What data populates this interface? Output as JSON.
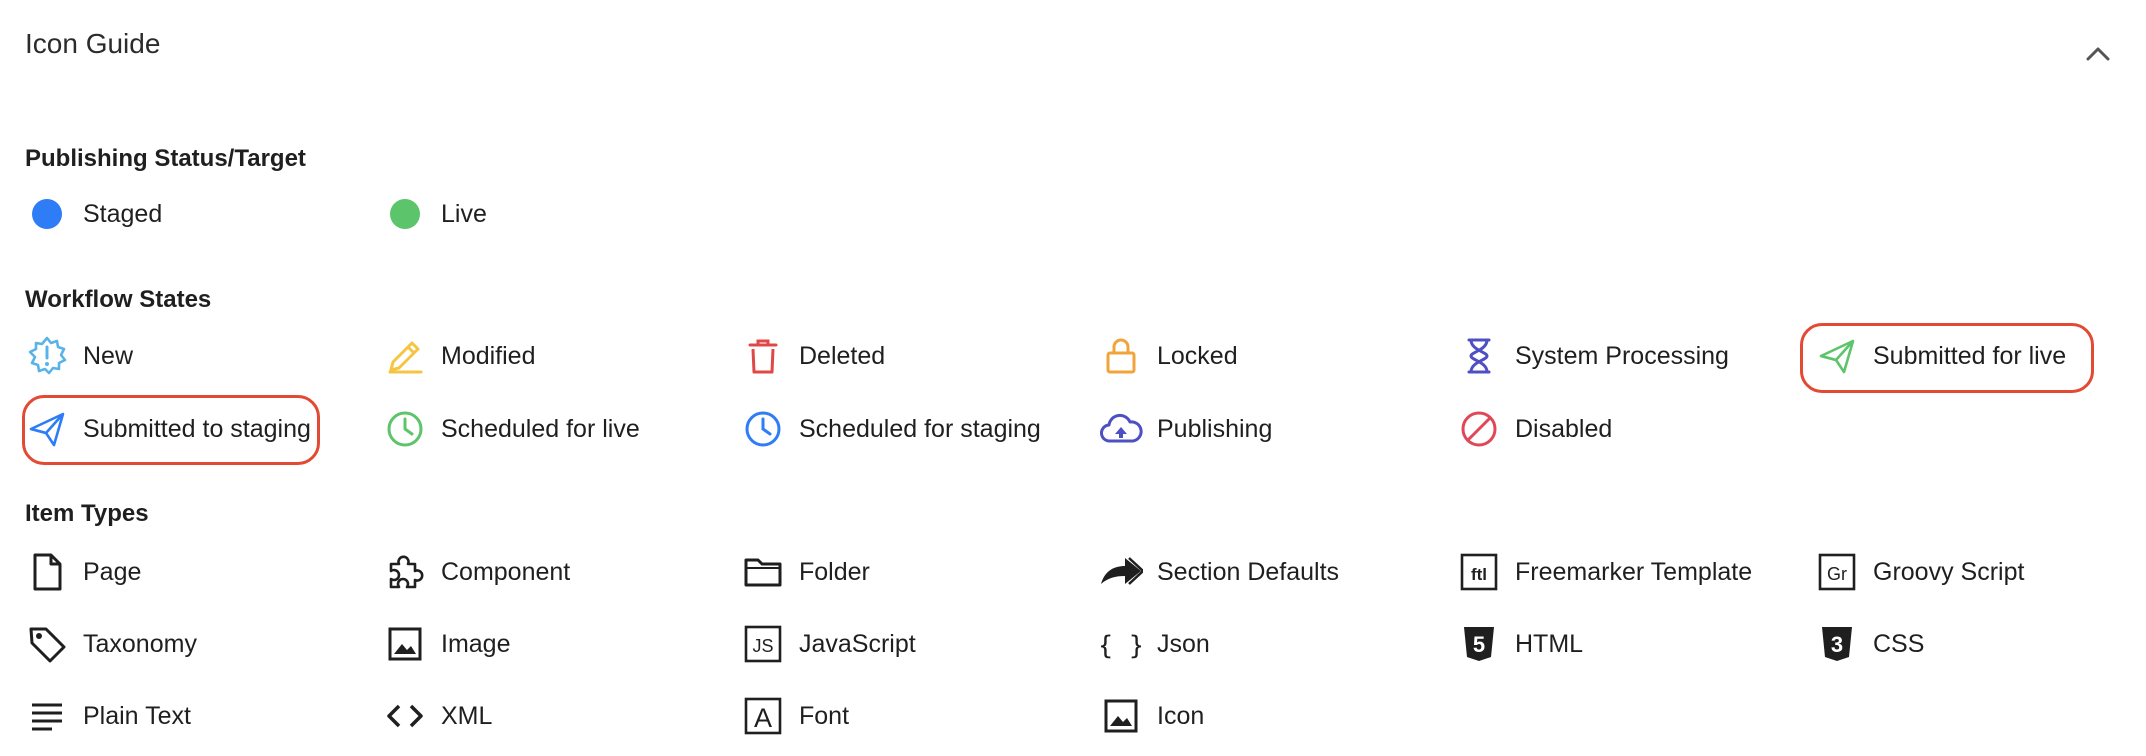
{
  "header": {
    "title": "Icon Guide"
  },
  "sections": {
    "publishing": {
      "title": "Publishing Status/Target"
    },
    "workflow": {
      "title": "Workflow States"
    },
    "item_types": {
      "title": "Item Types"
    }
  },
  "publishing_items": [
    {
      "label": "Staged",
      "icon": "staged-dot-icon",
      "color": "#2e7cf6"
    },
    {
      "label": "Live",
      "icon": "live-dot-icon",
      "color": "#5cc46a"
    }
  ],
  "workflow_items": [
    {
      "label": "New",
      "icon": "new-badge-icon",
      "color": "#5ab3e8"
    },
    {
      "label": "Modified",
      "icon": "pencil-icon",
      "color": "#f5c542"
    },
    {
      "label": "Deleted",
      "icon": "trash-icon",
      "color": "#e04848"
    },
    {
      "label": "Locked",
      "icon": "lock-icon",
      "color": "#f0a43a"
    },
    {
      "label": "System Processing",
      "icon": "hourglass-icon",
      "color": "#4f4fc4"
    },
    {
      "label": "Submitted for live",
      "icon": "send-live-icon",
      "color": "#5cc46a"
    },
    {
      "label": "Submitted to staging",
      "icon": "send-staging-icon",
      "color": "#2e7cf6"
    },
    {
      "label": "Scheduled for live",
      "icon": "clock-live-icon",
      "color": "#5cc46a"
    },
    {
      "label": "Scheduled for staging",
      "icon": "clock-staging-icon",
      "color": "#2e7cf6"
    },
    {
      "label": "Publishing",
      "icon": "cloud-upload-icon",
      "color": "#4f4fc4"
    },
    {
      "label": "Disabled",
      "icon": "disabled-icon",
      "color": "#e04858"
    }
  ],
  "item_type_items": [
    {
      "label": "Page",
      "icon": "page-icon"
    },
    {
      "label": "Component",
      "icon": "puzzle-icon"
    },
    {
      "label": "Folder",
      "icon": "folder-icon"
    },
    {
      "label": "Section Defaults",
      "icon": "share-arrow-icon"
    },
    {
      "label": "Freemarker Template",
      "icon": "ftl-icon",
      "icon_text": "ftl"
    },
    {
      "label": "Groovy Script",
      "icon": "groovy-icon",
      "icon_text": "Gr"
    },
    {
      "label": "Taxonomy",
      "icon": "tag-icon"
    },
    {
      "label": "Image",
      "icon": "image-icon"
    },
    {
      "label": "JavaScript",
      "icon": "js-icon",
      "icon_text": "JS"
    },
    {
      "label": "Json",
      "icon": "json-braces-icon",
      "icon_text": "{ }"
    },
    {
      "label": "HTML",
      "icon": "html5-icon",
      "icon_text": "5"
    },
    {
      "label": "CSS",
      "icon": "css3-icon",
      "icon_text": "3"
    },
    {
      "label": "Plain Text",
      "icon": "text-lines-icon"
    },
    {
      "label": "XML",
      "icon": "code-brackets-icon"
    },
    {
      "label": "Font",
      "icon": "font-icon",
      "icon_text": "A"
    },
    {
      "label": "Icon",
      "icon": "icon-image-icon"
    }
  ],
  "colors": {
    "highlight": "#e24a33",
    "text": "#1f1f1f"
  }
}
